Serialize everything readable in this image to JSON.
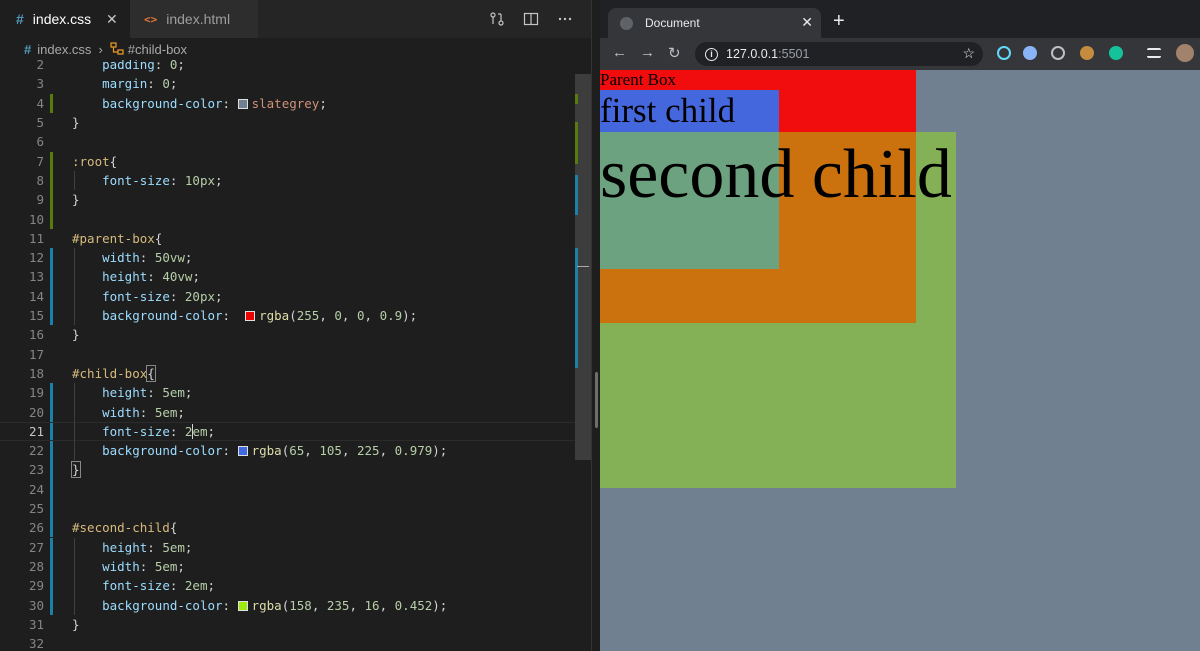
{
  "editor": {
    "tabs": [
      {
        "icon": "#",
        "label": "index.css",
        "active": true
      },
      {
        "icon": "<>",
        "label": "index.html",
        "active": false
      }
    ],
    "breadcrumb": {
      "file": "index.css",
      "symbol": "#child-box"
    }
  },
  "code_lines": [
    {
      "n": "2",
      "html": "    <span class='prop'>padding</span>: <span class='num'>0</span>;"
    },
    {
      "n": "3",
      "html": "    <span class='prop'>margin</span>: <span class='num'>0</span>;"
    },
    {
      "n": "4",
      "html": "    <span class='prop'>background-color</span>: <span class='swatch' style='background:slategrey'></span><span class='val'>slategrey</span>;"
    },
    {
      "n": "5",
      "html": "}"
    },
    {
      "n": "6",
      "html": ""
    },
    {
      "n": "7",
      "html": "<span class='sel'>:root</span>{"
    },
    {
      "n": "8",
      "html": "    <span class='prop'>font-size</span>: <span class='num'>10px</span>;"
    },
    {
      "n": "9",
      "html": "}"
    },
    {
      "n": "10",
      "html": ""
    },
    {
      "n": "11",
      "html": "<span class='sel'>#parent-box</span>{"
    },
    {
      "n": "12",
      "html": "    <span class='prop'>width</span>: <span class='num'>50vw</span>;"
    },
    {
      "n": "13",
      "html": "    <span class='prop'>height</span>: <span class='num'>40vw</span>;"
    },
    {
      "n": "14",
      "html": "    <span class='prop'>font-size</span>: <span class='num'>20px</span>;"
    },
    {
      "n": "15",
      "html": "    <span class='prop'>background-color</span>:  <span class='swatch' style='background:rgba(255,0,0,0.9)'></span><span class='fn'>rgba</span>(<span class='num'>255</span>, <span class='num'>0</span>, <span class='num'>0</span>, <span class='num'>0.9</span>);"
    },
    {
      "n": "16",
      "html": "}"
    },
    {
      "n": "17",
      "html": ""
    },
    {
      "n": "18",
      "html": "<span class='sel'>#child-box</span><span class='bm'>{</span>"
    },
    {
      "n": "19",
      "html": "    <span class='prop'>height</span>: <span class='num'>5em</span>;"
    },
    {
      "n": "20",
      "html": "    <span class='prop'>width</span>: <span class='num'>5em</span>;"
    },
    {
      "n": "21",
      "html": "    <span class='prop'>font-size</span>: <span class='num'>2<span class='caret'></span>em</span>;",
      "current": true
    },
    {
      "n": "22",
      "html": "    <span class='prop'>background-color</span>: <span class='swatch' style='background:rgb(65,105,225)'></span><span class='fn'>rgba</span>(<span class='num'>65</span>, <span class='num'>105</span>, <span class='num'>225</span>, <span class='num'>0.979</span>);"
    },
    {
      "n": "23",
      "html": "<span class='bm'>}</span>"
    },
    {
      "n": "24",
      "html": ""
    },
    {
      "n": "25",
      "html": ""
    },
    {
      "n": "26",
      "html": "<span class='sel'>#second-child</span>{"
    },
    {
      "n": "27",
      "html": "    <span class='prop'>height</span>: <span class='num'>5em</span>;"
    },
    {
      "n": "28",
      "html": "    <span class='prop'>width</span>: <span class='num'>5em</span>;"
    },
    {
      "n": "29",
      "html": "    <span class='prop'>font-size</span>: <span class='num'>2em</span>;"
    },
    {
      "n": "30",
      "html": "    <span class='prop'>background-color</span>: <span class='swatch' style='background:rgb(158,235,16)'></span><span class='fn'>rgba</span>(<span class='num'>158</span>, <span class='num'>235</span>, <span class='num'>16</span>, <span class='num'>0.452</span>);"
    },
    {
      "n": "31",
      "html": "}"
    },
    {
      "n": "32",
      "html": ""
    }
  ],
  "browser": {
    "tab_title": "Document",
    "url_host": "127.0.0.1",
    "url_port": ":5501"
  },
  "page": {
    "parent_text": "Parent Box",
    "first_child_text": "first child",
    "second_child_text": "second child"
  },
  "colors": {
    "page_bg": "#708090",
    "parent": "rgba(255,0,0,0.9)",
    "child": "rgba(65,105,225,0.979)",
    "second": "rgba(158,235,16,0.452)"
  }
}
